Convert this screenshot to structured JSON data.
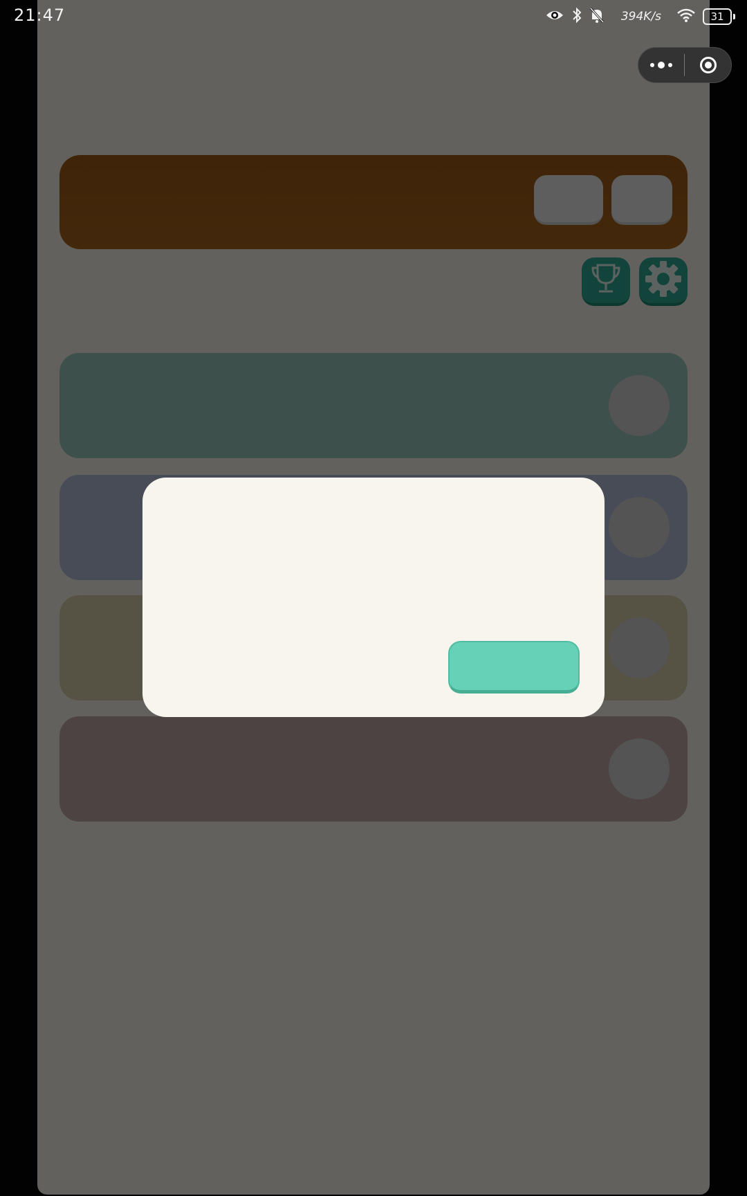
{
  "status_bar": {
    "time": "21:47",
    "network_speed": "394K/s",
    "battery_level": "31",
    "icons": [
      "eye-icon",
      "bluetooth-icon",
      "bell-off-icon",
      "wifi-icon",
      "battery-icon"
    ]
  },
  "mini_program_capsule": {
    "icons": [
      "more-dots-icon",
      "close-target-icon"
    ]
  },
  "top_panel": {
    "buttons": [
      "",
      ""
    ]
  },
  "toolbar": {
    "icons": [
      "trophy-icon",
      "gear-icon"
    ]
  },
  "mode_rows": [
    {
      "label": "",
      "color": "#9cc8bd"
    },
    {
      "label": "",
      "color": "#b3bfd6"
    },
    {
      "label": "",
      "color": "#d8ceaa"
    },
    {
      "label": "",
      "color": "#c4a8a8"
    }
  ],
  "dialog": {
    "title": "",
    "message": "",
    "confirm_label": ""
  },
  "colors": {
    "top_panel": "#a8641f",
    "icon_button": "#2eaa94",
    "confirm_button": "#66d1b6",
    "dialog_background": "#f7f5ee",
    "app_background": "#f6f2ea"
  }
}
